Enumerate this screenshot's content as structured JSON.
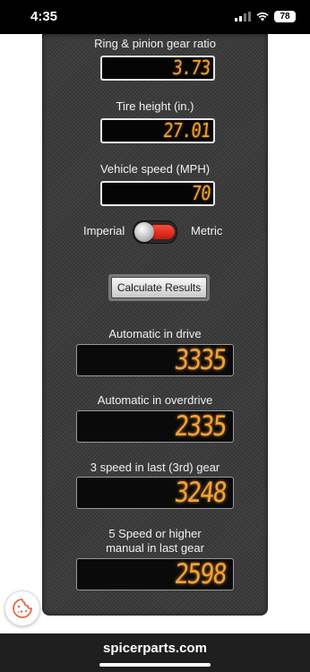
{
  "status_bar": {
    "time": "4:35",
    "battery": "78"
  },
  "calculator": {
    "inputs": [
      {
        "label": "Ring & pinion gear ratio",
        "value": "3.73"
      },
      {
        "label": "Tire height (in.)",
        "value": "27.01"
      },
      {
        "label": "Vehicle speed (MPH)",
        "value": "70"
      }
    ],
    "toggle": {
      "left_label": "Imperial",
      "right_label": "Metric",
      "state": "Imperial",
      "track_color": "#e0251a"
    },
    "calculate_button": "Calculate Results",
    "results": [
      {
        "label": "Automatic in drive",
        "value": "3335"
      },
      {
        "label": "Automatic in overdrive",
        "value": "2335"
      },
      {
        "label": "3 speed in last (3rd) gear",
        "value": "3248"
      },
      {
        "label_line1": "5 Speed or higher",
        "label_line2": "manual in last gear",
        "value": "2598"
      }
    ],
    "display_color": "#f3a23c"
  },
  "browser": {
    "url": "spicerparts.com"
  },
  "icons": {
    "cookie": "cookie-icon",
    "wifi": "wifi-icon",
    "signal": "signal-icon",
    "battery": "battery-icon"
  }
}
